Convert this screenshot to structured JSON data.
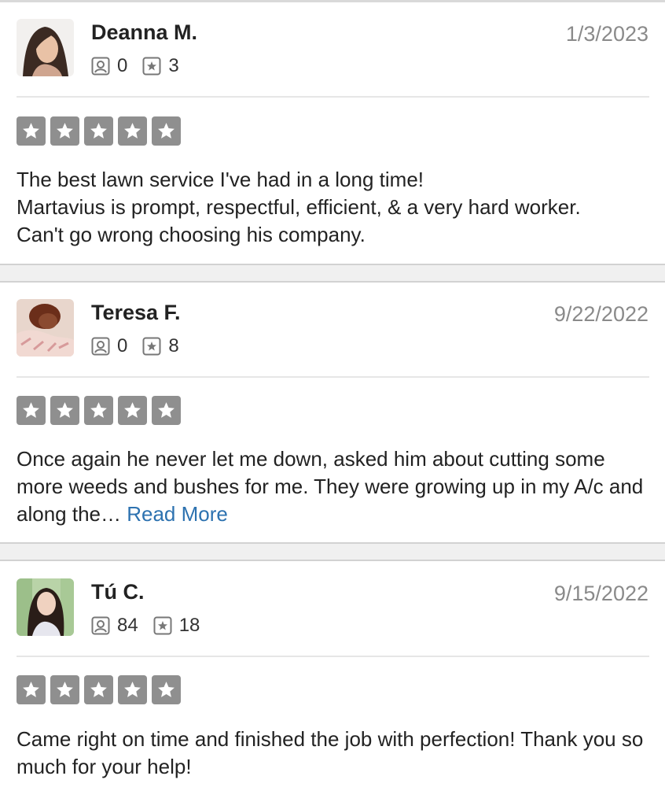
{
  "reviews": [
    {
      "name": "Deanna M.",
      "date": "1/3/2023",
      "photos": "0",
      "reviews": "3",
      "rating": 5,
      "lines": [
        "The best lawn service I've had in a long time!",
        "Martavius is prompt, respectful, efficient, & a very hard worker.",
        "Can't go wrong choosing his company."
      ]
    },
    {
      "name": "Teresa F.",
      "date": "9/22/2022",
      "photos": "0",
      "reviews": "8",
      "rating": 5,
      "text": "Once again he never let me down, asked him about cutting some more weeds and bushes for me. They were growing up in my A/c and along the…",
      "read_more": "Read More"
    },
    {
      "name": "Tú C.",
      "date": "9/15/2022",
      "photos": "84",
      "reviews": "18",
      "rating": 5,
      "text": "Came right on time and finished the job with perfection! Thank you so much for your help!"
    }
  ],
  "icons": {
    "photo_count": "photo-icon",
    "review_count": "star-review-icon",
    "rating_star": "star-icon"
  },
  "colors": {
    "star_box": "#8f8f8f",
    "link": "#2d72b0",
    "date": "#8a8a8a",
    "separator": "#f0f0f0"
  }
}
